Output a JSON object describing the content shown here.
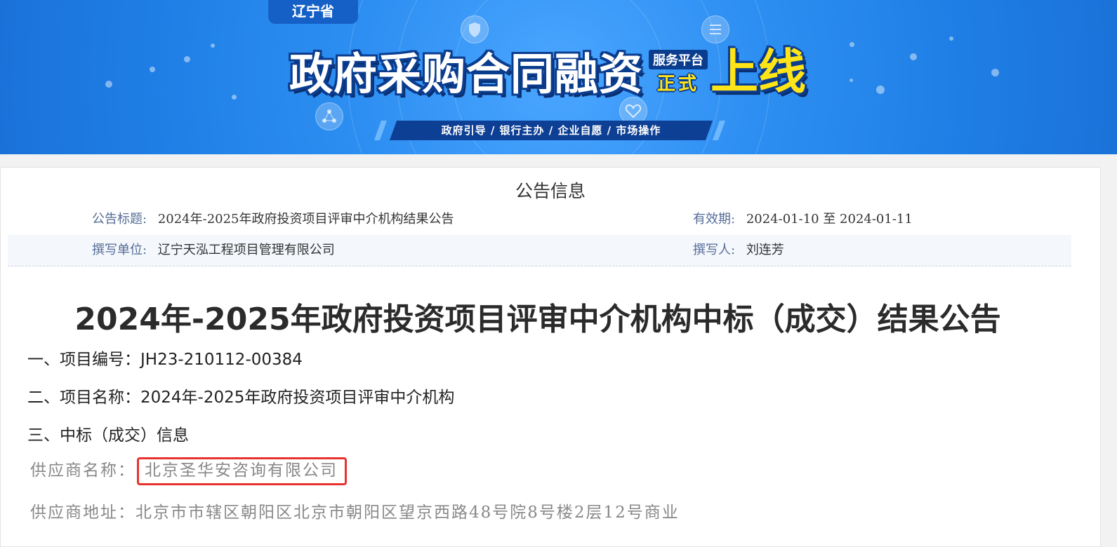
{
  "banner": {
    "province": "辽宁省",
    "headline_main": "政府采购合同融资",
    "headline_small": "服务平台",
    "headline_zs": "正式",
    "headline_big": "上线",
    "slogan": "政府引导 / 银行主办 / 企业自愿 / 市场操作",
    "colors": {
      "background": "#1f7fe6",
      "accent_yellow": "#ffe417",
      "dark_blue": "#0b3d8f"
    }
  },
  "notice": {
    "section_title": "公告信息",
    "title_label": "公告标题:",
    "title_value": "2024年-2025年政府投资项目评审中介机构结果公告",
    "validity_label": "有效期:",
    "validity_value": "2024-01-10 至 2024-01-11",
    "author_unit_label": "撰写单位:",
    "author_unit_value": "辽宁天泓工程项目管理有限公司",
    "author_label": "撰写人:",
    "author_value": "刘连芳"
  },
  "document": {
    "title": "2024年-2025年政府投资项目评审中介机构中标（成交）结果公告",
    "items": [
      "一、项目编号：JH23-210112-00384",
      "二、项目名称：2024年-2025年政府投资项目评审中介机构",
      "三、中标（成交）信息"
    ],
    "supplier_name_label": "供应商名称：",
    "supplier_name_value": "北京圣华安咨询有限公司",
    "supplier_address_label": "供应商地址：",
    "supplier_address_value": "北京市市辖区朝阳区北京市朝阳区望京西路48号院8号楼2层12号商业",
    "highlight_color": "#e8322e"
  }
}
